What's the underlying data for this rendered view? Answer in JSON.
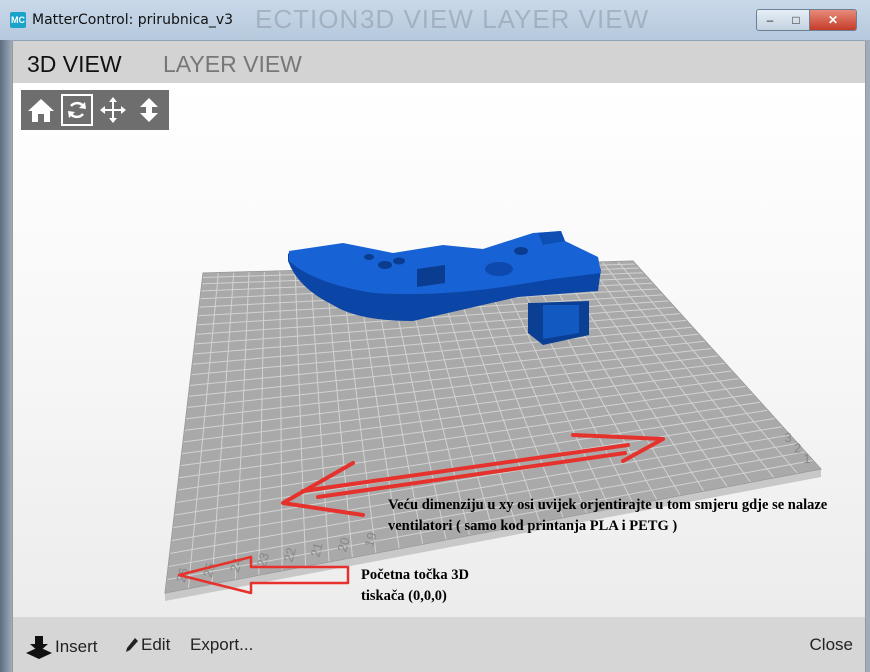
{
  "window": {
    "app_icon": "MC",
    "title": "MatterControl: prirubnica_v3",
    "ghost_left": "ECTION",
    "ghost_right": "3D VIEW   LAYER VIEW",
    "minimize": "–",
    "maximize": "□",
    "close": "✕"
  },
  "tabs": [
    {
      "label": "3D VIEW",
      "active": true
    },
    {
      "label": "LAYER VIEW",
      "active": false
    }
  ],
  "view_toolbar": [
    {
      "icon": "home-icon",
      "selected": false
    },
    {
      "icon": "rotate-icon",
      "selected": true
    },
    {
      "icon": "move-icon",
      "selected": false
    },
    {
      "icon": "zoom-icon",
      "selected": false
    }
  ],
  "bed": {
    "front_labels": [
      "26",
      "25",
      "24",
      "23",
      "22",
      "21",
      "20",
      "19"
    ],
    "right_labels": [
      "1",
      "2",
      "3"
    ]
  },
  "annotations": {
    "main": "Veću dimenziju u xy osi uvijek orjentirajte u tom smjeru gdje se nalaze ventilatori ( samo kod printanja PLA i PETG )",
    "origin_line1": "Početna točka 3D",
    "origin_line2": "tiskača (0,0,0)"
  },
  "colors": {
    "model": "#0f5bc4",
    "arrow": "#e5322d",
    "bed": "#a9a9a9"
  },
  "footer": {
    "insert": "Insert",
    "edit": "Edit",
    "export": "Export...",
    "close": "Close"
  }
}
